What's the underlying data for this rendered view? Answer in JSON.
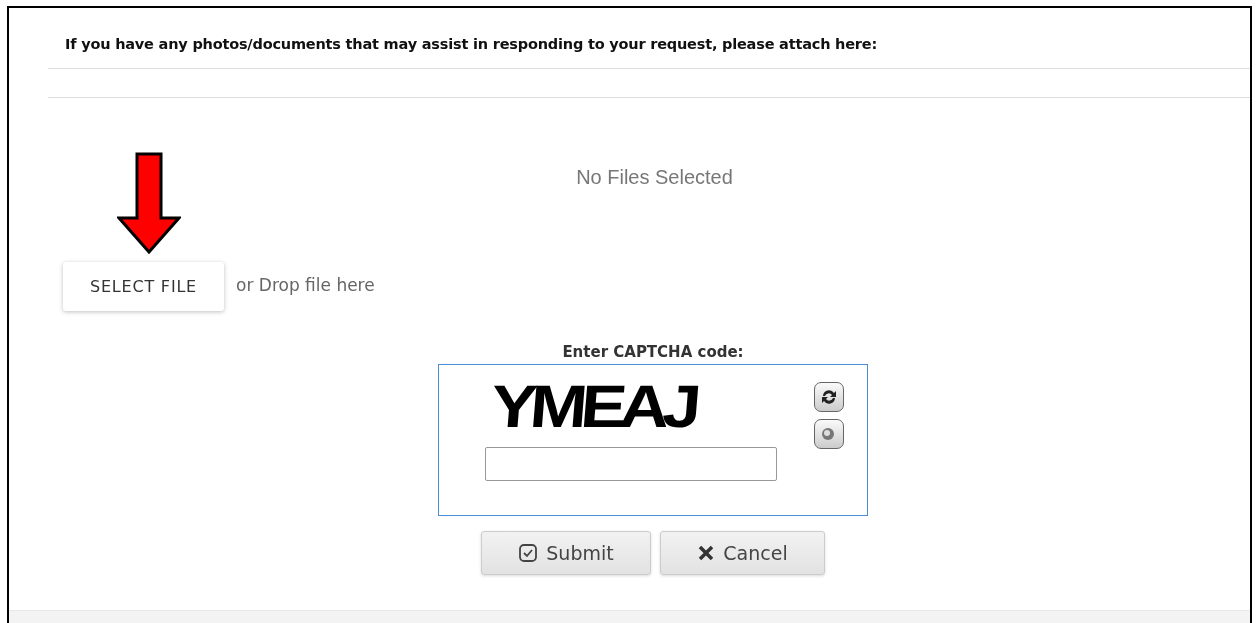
{
  "attachment": {
    "heading": "If you have any photos/documents that may assist in responding to your request, please attach here:",
    "status": "No Files Selected",
    "select_button": "SELECT FILE",
    "drop_hint": "or Drop file here"
  },
  "captcha": {
    "label": "Enter CAPTCHA code:",
    "code": "YMEAJ"
  },
  "buttons": [
    {
      "label": "Submit",
      "kind": "submit"
    },
    {
      "label": "Cancel",
      "kind": "cancel"
    }
  ]
}
